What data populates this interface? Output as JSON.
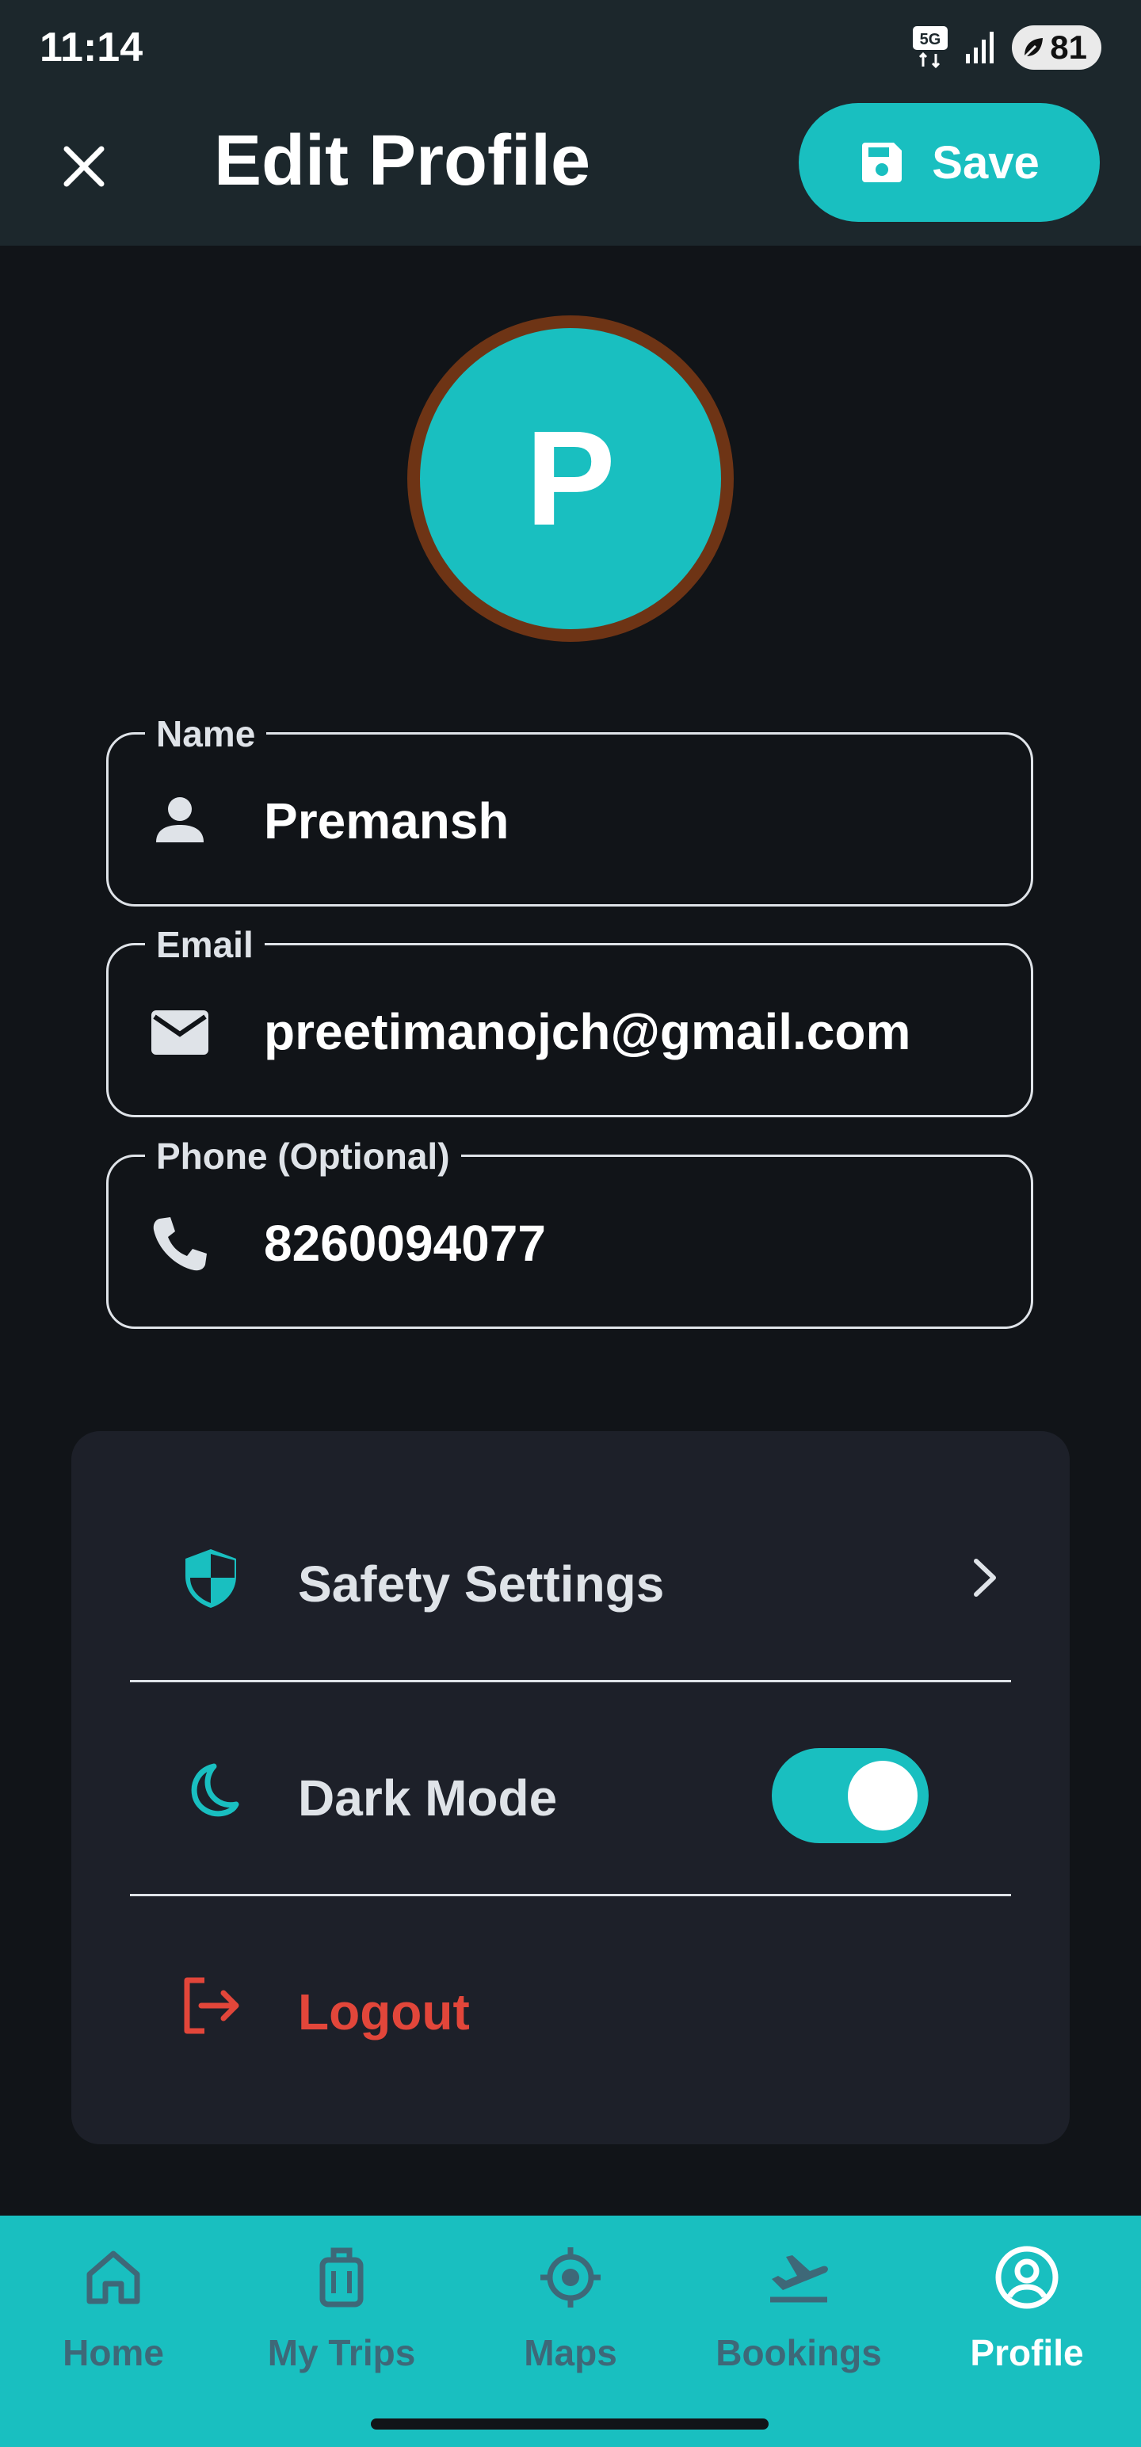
{
  "status_bar": {
    "time": "11:14",
    "network": "5G",
    "battery": "81"
  },
  "header": {
    "title": "Edit Profile",
    "save_label": "Save",
    "close_icon": "close-icon",
    "save_icon": "floppy-disk-icon"
  },
  "avatar": {
    "initial": "P"
  },
  "fields": {
    "name": {
      "label": "Name",
      "value": "Premansh",
      "icon": "person-icon"
    },
    "email": {
      "label": "Email",
      "value": "preetimanojch@gmail.com",
      "icon": "mail-icon"
    },
    "phone": {
      "label": "Phone (Optional)",
      "value": "8260094077",
      "icon": "phone-icon"
    }
  },
  "settings": {
    "safety_label": "Safety Settings",
    "dark_mode_label": "Dark Mode",
    "dark_mode_on": true,
    "logout_label": "Logout"
  },
  "bottom_nav": {
    "items": [
      {
        "label": "Home",
        "icon": "home-icon",
        "active": false
      },
      {
        "label": "My Trips",
        "icon": "luggage-icon",
        "active": false
      },
      {
        "label": "Maps",
        "icon": "location-target-icon",
        "active": false
      },
      {
        "label": "Bookings",
        "icon": "flight-takeoff-icon",
        "active": false
      },
      {
        "label": "Profile",
        "icon": "account-circle-icon",
        "active": true
      }
    ]
  },
  "colors": {
    "accent": "#19bfc0",
    "background": "#111418",
    "app_bar": "#1c272c",
    "card": "#1d2029",
    "logout": "#e2463a",
    "avatar_ring": "#6e3415",
    "nav_inactive": "#3e6878"
  }
}
